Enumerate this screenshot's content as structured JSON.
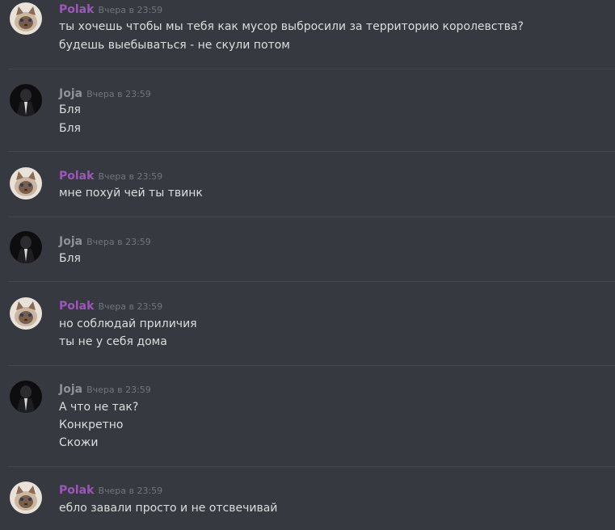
{
  "users": {
    "polak": {
      "name": "Polak",
      "color": "#9b59b6",
      "avatar_icon": "cat-avatar-icon"
    },
    "joja": {
      "name": "Joja",
      "color": "#8e9297",
      "avatar_icon": "dark-figure-avatar-icon"
    }
  },
  "messages": [
    {
      "author": "Polak",
      "timestamp": "Вчера в 23:59",
      "lines": [
        "ты хочешь чтобы мы тебя как мусор выбросили за территорию королевства?",
        "будешь выебываться - не скули потом"
      ]
    },
    {
      "author": "Joja",
      "timestamp": "Вчера в 23:59",
      "lines": [
        "Бля",
        "Бля"
      ]
    },
    {
      "author": "Polak",
      "timestamp": "Вчера в 23:59",
      "lines": [
        "мне похуй чей ты твинк"
      ]
    },
    {
      "author": "Joja",
      "timestamp": "Вчера в 23:59",
      "lines": [
        "Бля"
      ]
    },
    {
      "author": "Polak",
      "timestamp": "Вчера в 23:59",
      "lines": [
        "но соблюдай приличия",
        "ты не у себя дома"
      ]
    },
    {
      "author": "Joja",
      "timestamp": "Вчера в 23:59",
      "lines": [
        "А что не так?",
        "Конкретно",
        "Скожи"
      ]
    },
    {
      "author": "Polak",
      "timestamp": "Вчера в 23:59",
      "lines": [
        "ебло завали просто и не отсвечивай"
      ]
    }
  ]
}
